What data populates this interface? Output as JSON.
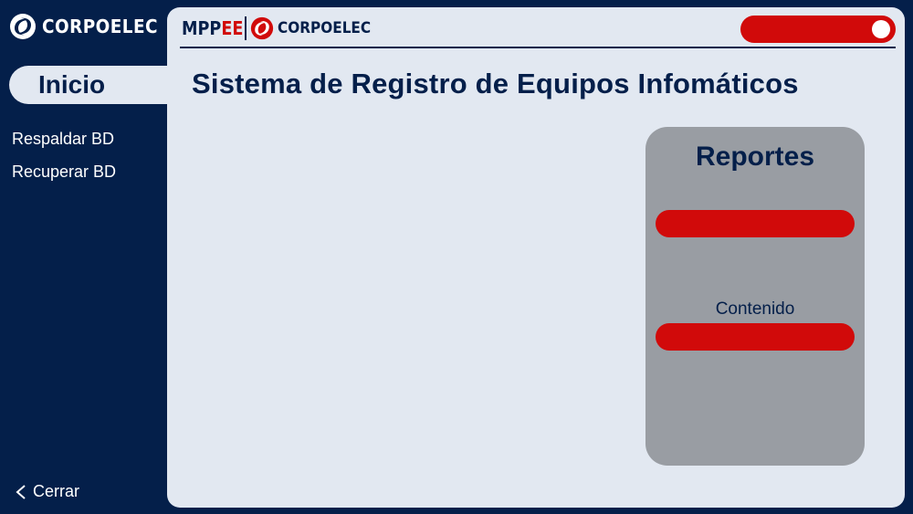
{
  "brand": {
    "name": "CORPOELEC",
    "logo_icon": "corpoelec-swirl-icon"
  },
  "sidebar": {
    "active_item": "Inicio",
    "items": [
      {
        "label": "Respaldar BD"
      },
      {
        "label": "Recuperar BD"
      }
    ],
    "logout": {
      "label": "Cerrar",
      "icon": "chevron-left-icon"
    }
  },
  "header": {
    "ministry_main": "MPP",
    "ministry_accent": "EE",
    "corp_name": "CORPOELEC"
  },
  "main": {
    "title": "Sistema de Registro de Equipos Infomáticos"
  },
  "card": {
    "title": "Reportes",
    "content_label": "Contenido"
  },
  "colors": {
    "navy": "#041f4a",
    "panel": "#e2e8f1",
    "accent_red": "#d10a0a",
    "card_gray": "#999da3"
  }
}
